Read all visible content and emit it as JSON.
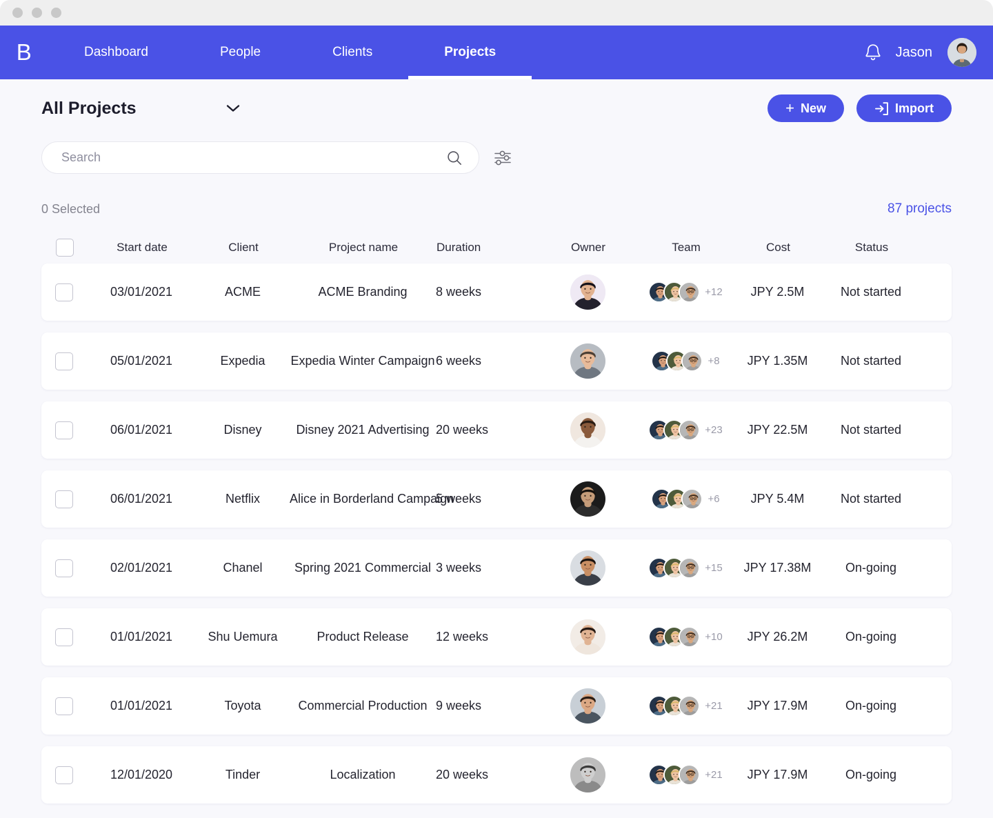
{
  "window": {
    "traffic_lights": [
      "close",
      "minimize",
      "maximize"
    ]
  },
  "navbar": {
    "brand": "B",
    "items": [
      {
        "label": "Dashboard",
        "active": false
      },
      {
        "label": "People",
        "active": false
      },
      {
        "label": "Clients",
        "active": false
      },
      {
        "label": "Projects",
        "active": true
      }
    ],
    "notifications_icon": "bell-icon",
    "user_name": "Jason",
    "avatar": "user-avatar"
  },
  "header": {
    "title": "All Projects",
    "dropdown_icon": "chevron-down-icon",
    "new_button": "New",
    "new_button_icon": "plus-icon",
    "import_button": "Import",
    "import_button_icon": "import-icon"
  },
  "search": {
    "placeholder": "Search",
    "value": "",
    "search_icon": "search-icon",
    "filter_icon": "sliders-icon"
  },
  "toolbar": {
    "selected_label": "0 Selected",
    "project_count": "87 projects"
  },
  "colors": {
    "accent": "#4A52E6",
    "background": "#F8F8FC",
    "card": "#FFFFFF",
    "titlebar": "#EFEFEF",
    "link": "#4A52E6",
    "muted_text": "#84848F"
  },
  "table": {
    "columns": [
      "",
      "Start date",
      "Client",
      "Project name",
      "Duration",
      "Owner",
      "Team",
      "Cost",
      "Status"
    ],
    "rows": [
      {
        "selected": false,
        "start_date": "03/01/2021",
        "client": "ACME",
        "project_name": "ACME Branding",
        "duration": "8 weeks",
        "team_extra": "+12",
        "cost": "JPY 2.5M",
        "status": "Not started"
      },
      {
        "selected": false,
        "start_date": "05/01/2021",
        "client": "Expedia",
        "project_name": "Expedia Winter Campaign",
        "duration": "6 weeks",
        "team_extra": "+8",
        "cost": "JPY 1.35M",
        "status": "Not started"
      },
      {
        "selected": false,
        "start_date": "06/01/2021",
        "client": "Disney",
        "project_name": "Disney 2021 Advertising",
        "duration": "20 weeks",
        "team_extra": "+23",
        "cost": "JPY 22.5M",
        "status": "Not started"
      },
      {
        "selected": false,
        "start_date": "06/01/2021",
        "client": "Netflix",
        "project_name": "Alice in Borderland Campaign",
        "duration": "5 weeks",
        "team_extra": "+6",
        "cost": "JPY 5.4M",
        "status": "Not started"
      },
      {
        "selected": false,
        "start_date": "02/01/2021",
        "client": "Chanel",
        "project_name": "Spring 2021 Commercial",
        "duration": "3 weeks",
        "team_extra": "+15",
        "cost": "JPY 17.38M",
        "status": "On-going"
      },
      {
        "selected": false,
        "start_date": "01/01/2021",
        "client": "Shu Uemura",
        "project_name": "Product Release",
        "duration": "12 weeks",
        "team_extra": "+10",
        "cost": "JPY 26.2M",
        "status": "On-going"
      },
      {
        "selected": false,
        "start_date": "01/01/2021",
        "client": "Toyota",
        "project_name": "Commercial Production",
        "duration": "9 weeks",
        "team_extra": "+21",
        "cost": "JPY 17.9M",
        "status": "On-going"
      },
      {
        "selected": false,
        "start_date": "12/01/2020",
        "client": "Tinder",
        "project_name": "Localization",
        "duration": "20 weeks",
        "team_extra": "+21",
        "cost": "JPY 17.9M",
        "status": "On-going"
      }
    ]
  }
}
